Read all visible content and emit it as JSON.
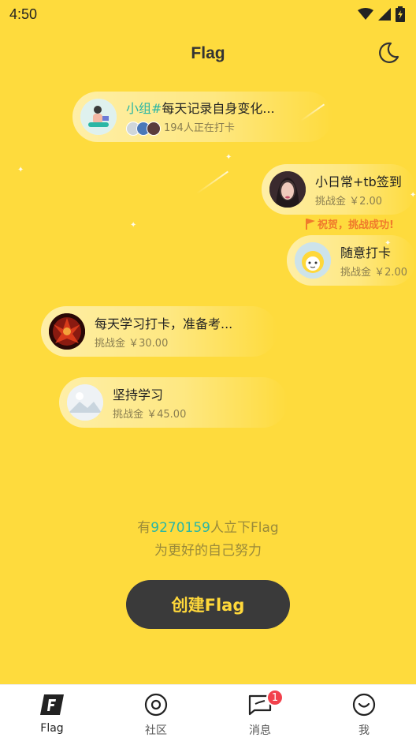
{
  "status_bar": {
    "time": "4:50"
  },
  "header": {
    "title": "Flag",
    "moon_icon": "moon-icon"
  },
  "flags": [
    {
      "group_tag": "小组#",
      "title": "每天记录自身变化...",
      "subtitle": "194人正在打卡",
      "avatar": "illustration-avatar"
    },
    {
      "title": "小日常+tb签到",
      "subtitle": "挑战金 ￥2.00",
      "avatar": "portrait-avatar"
    },
    {
      "title": "随意打卡",
      "subtitle": "挑战金 ￥2.00",
      "avatar": "cartoon-avatar"
    },
    {
      "title": "每天学习打卡，准备考...",
      "subtitle": "挑战金 ￥30.00",
      "avatar": "fire-avatar"
    },
    {
      "title": "坚持学习",
      "subtitle": "挑战金 ￥45.00",
      "avatar": "landscape-avatar"
    }
  ],
  "success_note": "祝贺，挑战成功!",
  "stats": {
    "prefix": "有",
    "count": "9270159",
    "suffix": "人立下Flag",
    "line2": "为更好的自己努力"
  },
  "create_button": "创建Flag",
  "tabs": [
    {
      "label": "Flag",
      "icon": "flag-f-icon",
      "active": true
    },
    {
      "label": "社区",
      "icon": "community-icon"
    },
    {
      "label": "消息",
      "icon": "message-icon",
      "badge": "1"
    },
    {
      "label": "我",
      "icon": "smile-icon"
    }
  ],
  "colors": {
    "background": "#fedb3d",
    "accent": "#2bb6a4",
    "button": "#3a3a3a",
    "button_text": "#ffd83a",
    "badge": "#f2414c"
  }
}
